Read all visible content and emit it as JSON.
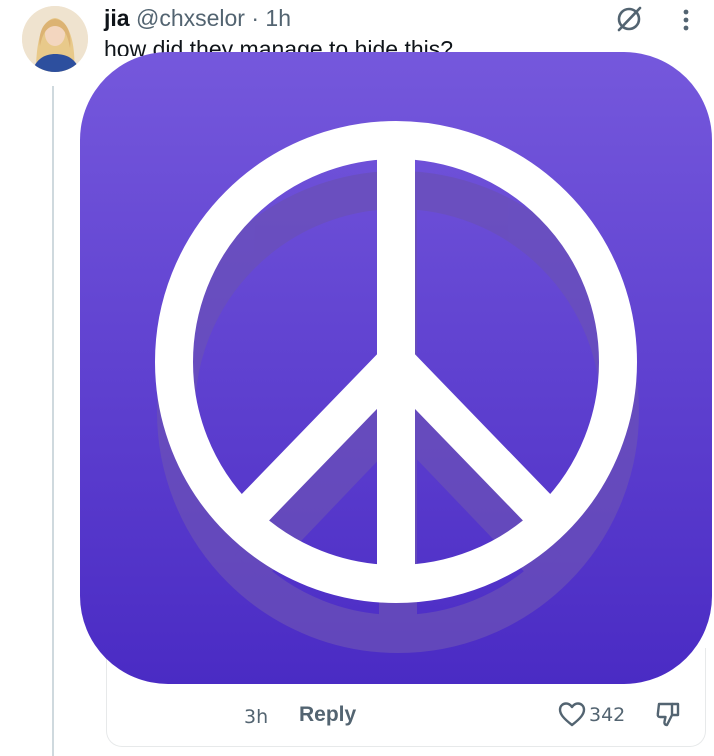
{
  "tweet": {
    "author_name": "jia",
    "author_handle": "@chxselor",
    "separator": "·",
    "time": "1h",
    "text": "how did they manage to hide this?"
  },
  "reply_bar": {
    "time": "3h",
    "reply_label": "Reply",
    "like_count": "342"
  },
  "image": {
    "subject": "peace-sign-app-icon",
    "gradient_top": "#7558dc",
    "gradient_bottom": "#4a2bc4"
  },
  "colors": {
    "text_primary": "#0f1419",
    "text_secondary": "#536471",
    "border": "#e7e9ea"
  }
}
